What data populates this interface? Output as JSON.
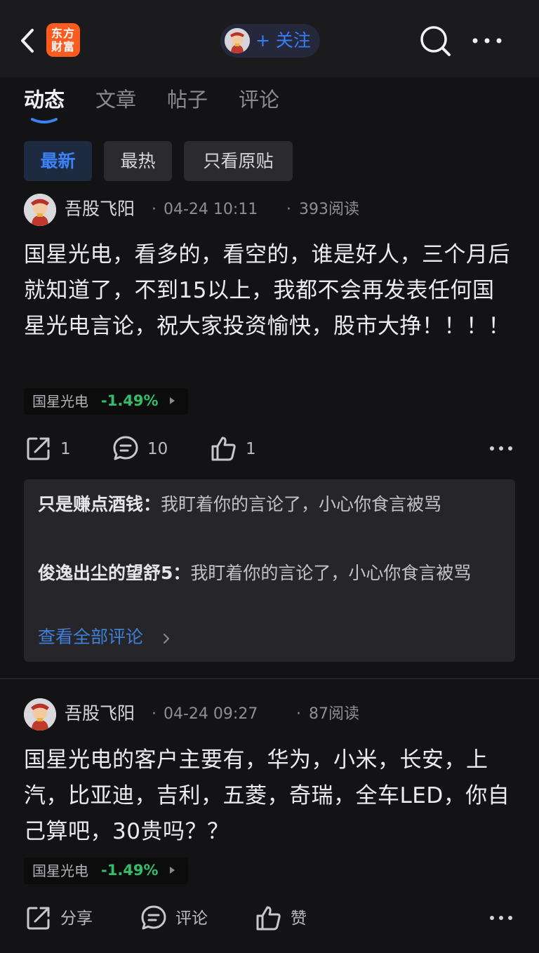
{
  "nav": {
    "logo_line1": "东方",
    "logo_line2": "财富",
    "follow_label": "+ 关注"
  },
  "tabs": [
    {
      "label": "动态",
      "active": true
    },
    {
      "label": "文章",
      "active": false
    },
    {
      "label": "帖子",
      "active": false
    },
    {
      "label": "评论",
      "active": false
    }
  ],
  "filters": [
    {
      "label": "最新",
      "active": true
    },
    {
      "label": "最热",
      "active": false
    },
    {
      "label": "只看原贴",
      "active": false
    }
  ],
  "posts": [
    {
      "author": "吾股飞阳",
      "time": "04-24 10:11",
      "reads": "393阅读",
      "content": "国星光电，看多的，看空的，谁是好人，三个月后就知道了，不到15以上，我都不会再发表任何国星光电言论，祝大家投资愉快，股市大挣！！！！",
      "stock": {
        "name": "国星光电",
        "change": "-1.49%"
      },
      "actions": {
        "share": "1",
        "comment": "10",
        "like": "1"
      },
      "comments": [
        {
          "name": "只是赚点酒钱",
          "text": "我盯着你的言论了，小心你食言被骂"
        },
        {
          "name": "俊逸出尘的望舒5",
          "text": "我盯着你的言论了，小心你食言被骂"
        }
      ],
      "view_all": "查看全部评论"
    },
    {
      "author": "吾股飞阳",
      "time": "04-24 09:27",
      "reads": "87阅读",
      "content": "国星光电的客户主要有，华为，小米，长安，上汽，比亚迪，吉利，五菱，奇瑞，全车LED，你自己算吧，30贵吗？？",
      "stock": {
        "name": "国星光电",
        "change": "-1.49%"
      },
      "actions": {
        "share": "分享",
        "comment": "评论",
        "like": "赞"
      }
    }
  ],
  "colors": {
    "background": "#131315",
    "accent": "#3b82f6",
    "logo": "#ff5a1f",
    "stock_down": "#2fbf6b"
  }
}
